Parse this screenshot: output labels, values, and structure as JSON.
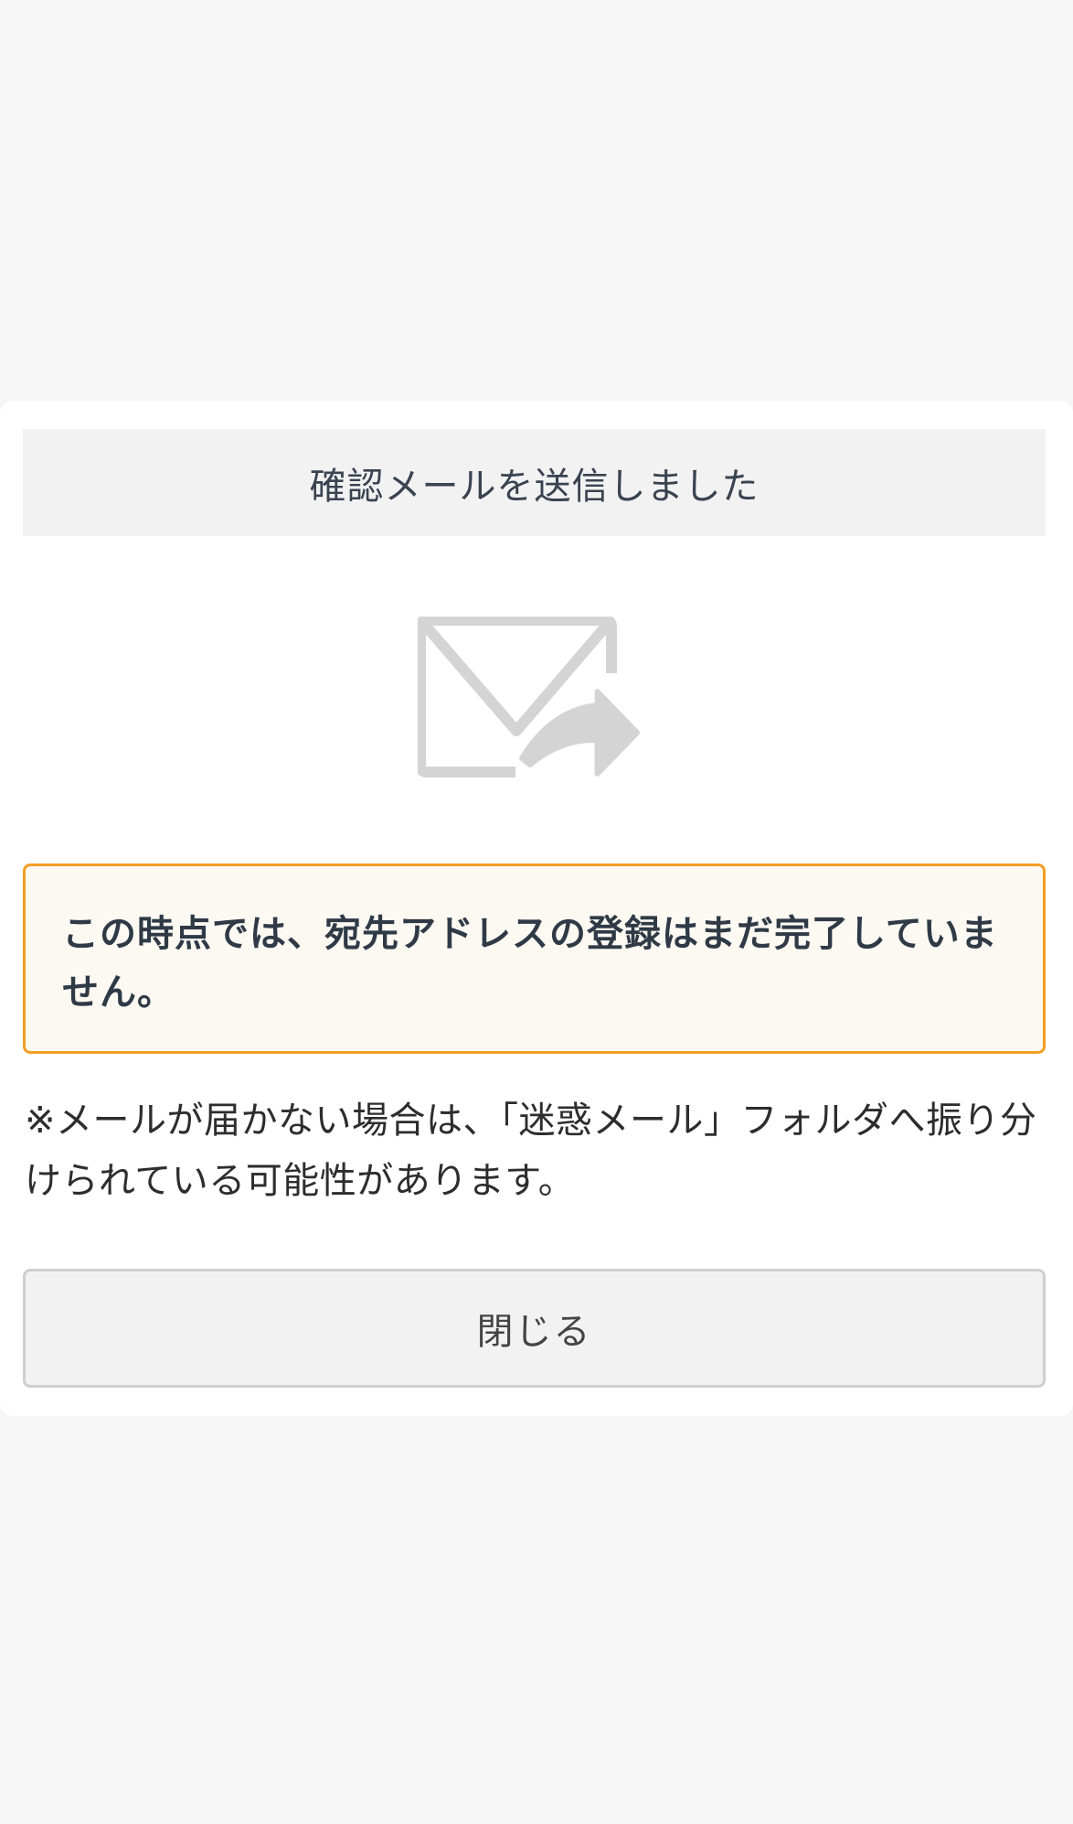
{
  "dialog": {
    "title": "確認メールを送信しました",
    "icon": "mail-forward-icon",
    "notice": "この時点では、宛先アドレスの登録はまだ完了していません。",
    "note": "※メールが届かない場合は、「迷惑メール」フォルダへ振り分けられている可能性があります。",
    "close_label": "閉じる"
  },
  "colors": {
    "page_background": "#f6f6f6",
    "header_background": "#f2f2f2",
    "notice_border": "#f29e26",
    "notice_background": "#fcf9f3",
    "icon_gray": "#d4d4d4"
  }
}
